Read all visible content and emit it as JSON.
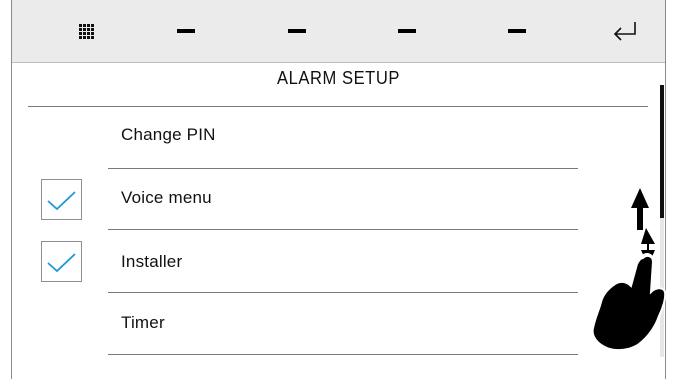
{
  "topbar": {
    "menu_icon": "grid-menu-icon",
    "slots": [
      "dash-icon",
      "dash-icon",
      "dash-icon",
      "dash-icon"
    ],
    "back_icon": "return-arrow-icon"
  },
  "page": {
    "title": "ALARM SETUP"
  },
  "menu": {
    "items": [
      {
        "label": "Change PIN",
        "checked": false
      },
      {
        "label": "Voice menu",
        "checked": true
      },
      {
        "label": "Installer",
        "checked": true
      },
      {
        "label": "Timer",
        "checked": false
      }
    ]
  },
  "colors": {
    "check": "#1a9bd6",
    "topbar": "#ebebeb"
  },
  "overlay": {
    "icon": "swipe-up-down-gesture-icon"
  }
}
